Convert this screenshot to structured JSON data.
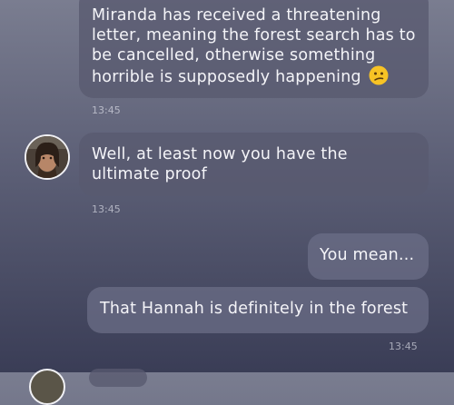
{
  "messages": [
    {
      "text": "Miranda has received a threatening letter, meaning the forest search has to be cancelled, otherwise something horrible is supposedly happening",
      "emoji": "confused-face",
      "time": "13:45"
    },
    {
      "text": "Well, at least now you have the ultimate proof",
      "time": "13:45"
    },
    {
      "text": "You mean..."
    },
    {
      "text": "That Hannah is definitely in the forest",
      "time": "13:45"
    }
  ]
}
